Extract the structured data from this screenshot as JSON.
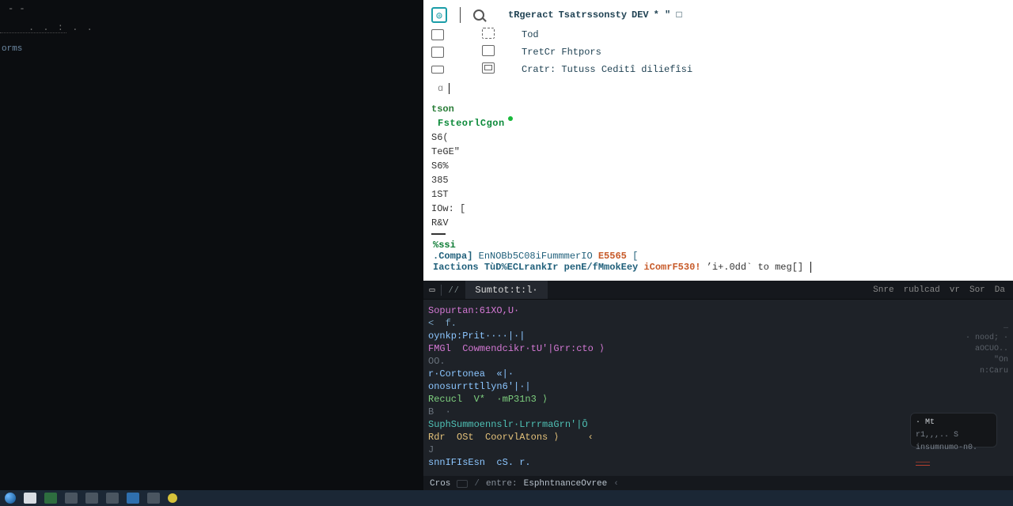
{
  "left": {
    "dash": "- -",
    "dots": ". . : . .",
    "label": "orms"
  },
  "toolbar": {
    "logo_glyph": "◎",
    "crumbs": [
      "tRgeract",
      "Tsatrssonsty",
      "DEV"
    ],
    "crumb_tail": "* \" □"
  },
  "subrows": [
    {
      "label": "Tod"
    },
    {
      "label": "TretCr  Fhtpors"
    },
    {
      "label": "Cratr: Tutuss Ceditî diliefîsi"
    }
  ],
  "lines": {
    "header": "tson",
    "headline": "FsteorlCgon",
    "nums": [
      "S6(",
      "TeGE\"",
      "S6%",
      "385",
      "1ST",
      "IOw:  [",
      "R&V"
    ]
  },
  "messages": {
    "head": "%ssi",
    "m1_a": ".Compa]",
    "m1_b": "EnNOBb5C08iFummmerIO",
    "m1_c": "E5565",
    "m1_d": "[",
    "m2_a": "Iactions",
    "m2_b": "TùD%ECLrankIr  penE/fMmokEey",
    "m2_q": "iComrF530!",
    "m2_r": "’i+.0dd` to meg[]"
  },
  "devtools": {
    "tab": "Sumtot:t:l·",
    "right_tabs": [
      "Snre",
      "rublcad",
      "vr",
      "Sor",
      "Da"
    ],
    "right_col": [
      "…",
      "·  nood; ·",
      "aOCUO..",
      "\"On n:Caru"
    ],
    "code": [
      {
        "raw": "Sopurtan:61XO,U·"
      },
      {
        "raw": "<  f."
      },
      {
        "raw": "oynkp:Prit····|·|"
      },
      {
        "raw": "FMGl  Cowmendcikr·tU'|Grr:cto ⟩"
      },
      {
        "raw": "OO."
      },
      {
        "raw": "r·Cortonea  «|·"
      },
      {
        "raw": "onosurrttllyn6'|·|"
      },
      {
        "raw": "Recucl  V*  ·mP31n3 ⟩"
      },
      {
        "raw": "B  ·"
      },
      {
        "raw": "SuphSummoennslr·LrrrmaGrn'|Ō"
      },
      {
        "raw": "Rdr  OSt  CoorvlAtons ⟩     ‹"
      },
      {
        "raw": "J"
      },
      {
        "raw": "snnIFIsEsn  cS. r."
      }
    ],
    "breadcrumb": [
      "Cros",
      "/",
      "entre:",
      "EsphntnanceOvree",
      "‹"
    ]
  },
  "ghost": {
    "cap": "· Mt",
    "line": "r1,,,.. S insumnumo-n0.",
    "hl": "———"
  },
  "taskbar": {
    "items": [
      "start",
      "files",
      "app-g",
      "search",
      "grid",
      "store",
      "edge",
      "mail",
      "chat-y"
    ]
  }
}
